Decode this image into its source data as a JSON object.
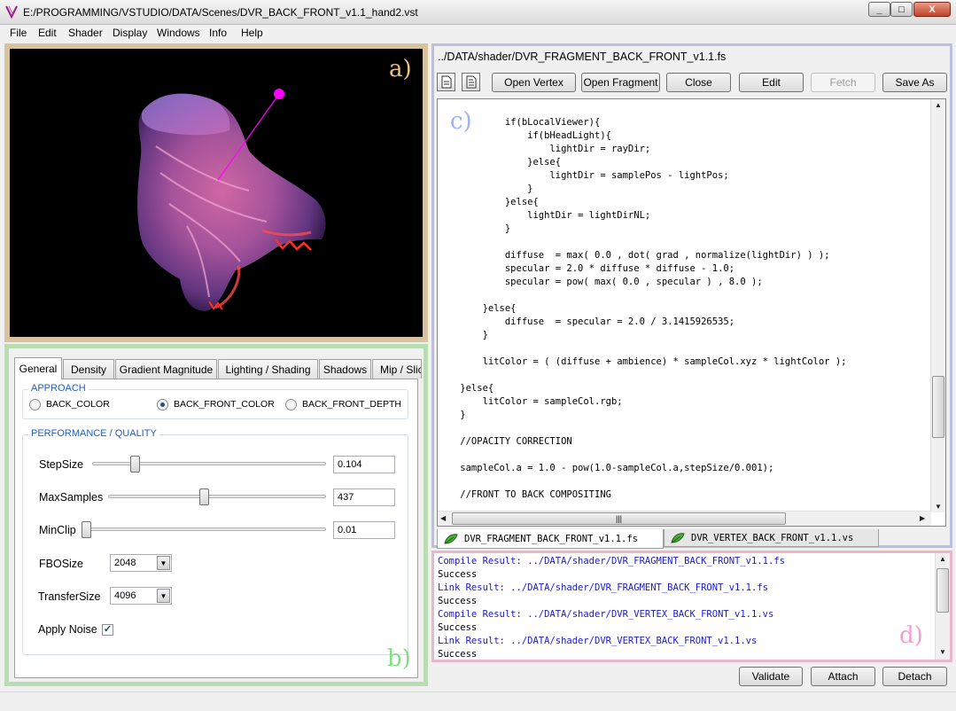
{
  "window": {
    "title": "E:/PROGRAMMING/VSTUDIO/DATA/Scenes/DVR_BACK_FRONT_v1.1_hand2.vst",
    "min_label": "_",
    "max_label": "□",
    "close_label": "X"
  },
  "menu": [
    "File",
    "Edit",
    "Shader",
    "Display",
    "Windows",
    "Info",
    "Help"
  ],
  "viewport": {
    "label": "a)",
    "label_color": "#f0c080",
    "light_color": "#ff00ff"
  },
  "controls": {
    "label": "b)",
    "label_color": "#7fe07f",
    "tabs": [
      "General",
      "Density",
      "Gradient Magnitude",
      "Lighting / Shading",
      "Shadows",
      "Mip / Slicing"
    ],
    "approach": {
      "title": "APPROACH",
      "options": [
        "BACK_COLOR",
        "BACK_FRONT_COLOR",
        "BACK_FRONT_DEPTH"
      ],
      "selected": "BACK_FRONT_COLOR"
    },
    "performance": {
      "title": "PERFORMANCE / QUALITY",
      "step_size": {
        "label": "StepSize",
        "value": "0.104",
        "fraction": 0.1
      },
      "max_samples": {
        "label": "MaxSamples",
        "value": "437",
        "fraction": 0.44
      },
      "min_clip": {
        "label": "MinClip",
        "value": "0.01",
        "fraction": 0.0
      },
      "fbo_size": {
        "label": "FBOSize",
        "value": "2048"
      },
      "transfer_size": {
        "label": "TransferSize",
        "value": "4096"
      },
      "apply_noise": {
        "label": "Apply Noise",
        "checked": true,
        "mark": "✓"
      }
    }
  },
  "editor": {
    "label": "c)",
    "label_color": "#9fb4f0",
    "path": "../DATA/shader/DVR_FRAGMENT_BACK_FRONT_v1.1.fs",
    "buttons": {
      "open_vertex": "Open Vertex",
      "open_fragment": "Open Fragment",
      "close": "Close",
      "edit": "Edit",
      "fetch": "Fetch",
      "save_as": "Save As"
    },
    "code": [
      "",
      "            if(bLocalViewer){",
      "                if(bHeadLight){",
      "                    lightDir = rayDir;",
      "                }else{",
      "                    lightDir = samplePos - lightPos;",
      "                }",
      "            }else{",
      "                lightDir = lightDirNL;",
      "            }",
      "",
      "            diffuse  = max( 0.0 , dot( grad , normalize(lightDir) ) );",
      "            specular = 2.0 * diffuse * diffuse - 1.0;",
      "            specular = pow( max( 0.0 , specular ) , 8.0 );",
      "",
      "        }else{",
      "            diffuse  = specular = 2.0 / 3.1415926535;",
      "        }",
      "",
      "        litColor = ( (diffuse + ambience) * sampleCol.xyz * lightColor );",
      "",
      "    }else{",
      "        litColor = sampleCol.rgb;",
      "    }",
      "",
      "    //OPACITY CORRECTION",
      "",
      "    sampleCol.a = 1.0 - pow(1.0-sampleCol.a,stepSize/0.001);",
      "",
      "    //FRONT TO BACK COMPOSITING"
    ],
    "hscroll_grip": "|||",
    "file_tabs": [
      "DVR_FRAGMENT_BACK_FRONT_v1.1.fs",
      "DVR_VERTEX_BACK_FRONT_v1.1.vs"
    ]
  },
  "console": {
    "label": "d)",
    "label_color": "#f0a0d0",
    "lines": [
      {
        "text": "Compile Result: ../DATA/shader/DVR_FRAGMENT_BACK_FRONT_v1.1.fs",
        "kind": "blue"
      },
      {
        "text": "Success",
        "kind": "plain"
      },
      {
        "text": "Link Result: ../DATA/shader/DVR_FRAGMENT_BACK_FRONT_v1.1.fs",
        "kind": "blue"
      },
      {
        "text": "Success",
        "kind": "plain"
      },
      {
        "text": "Compile Result: ../DATA/shader/DVR_VERTEX_BACK_FRONT_v1.1.vs",
        "kind": "blue"
      },
      {
        "text": "Success",
        "kind": "plain"
      },
      {
        "text": "Link Result: ../DATA/shader/DVR_VERTEX_BACK_FRONT_v1.1.vs",
        "kind": "blue"
      },
      {
        "text": "Success",
        "kind": "plain"
      }
    ]
  },
  "actions": {
    "validate": "Validate",
    "attach": "Attach",
    "detach": "Detach"
  }
}
